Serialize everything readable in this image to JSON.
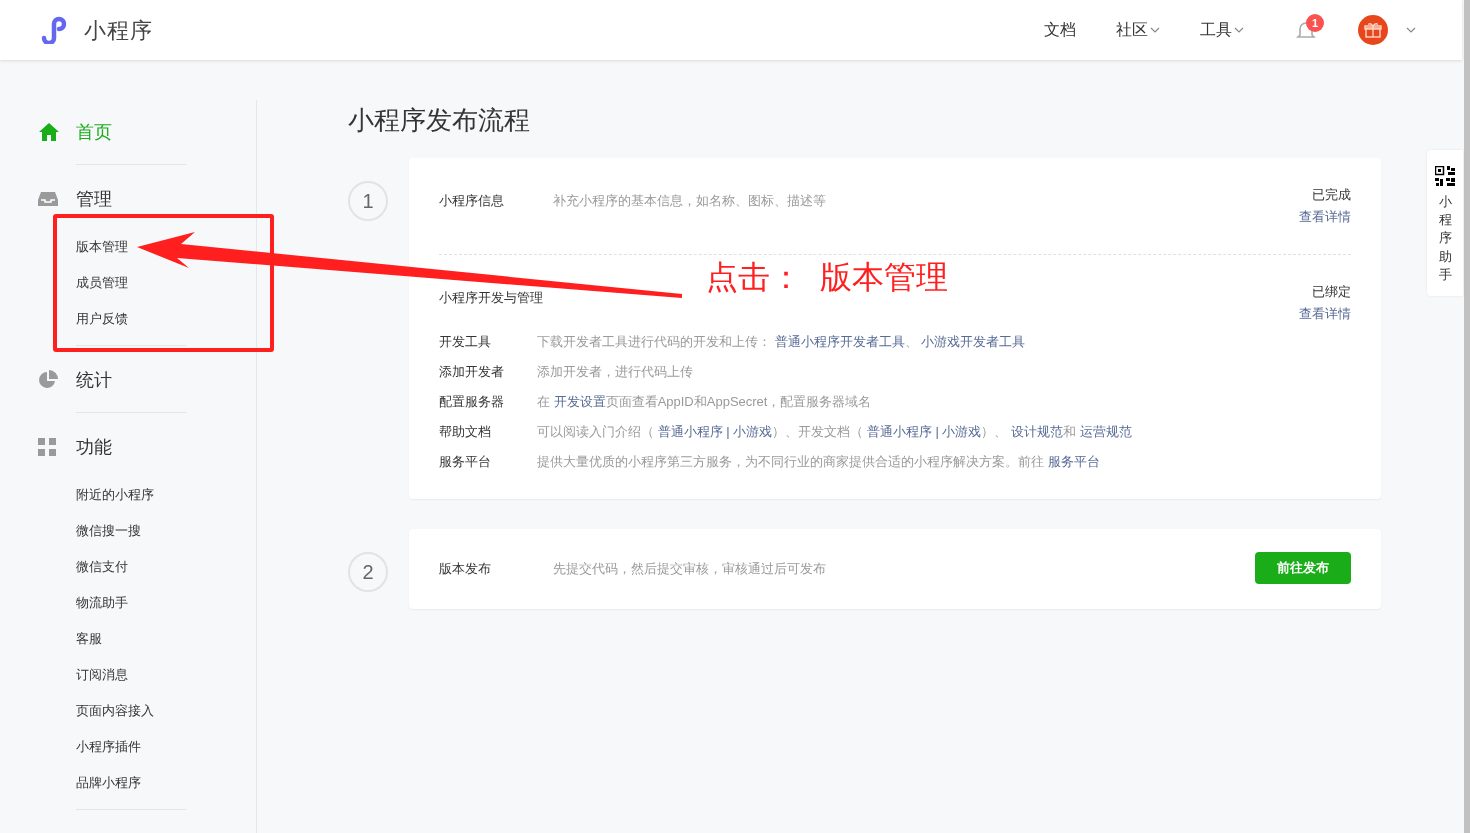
{
  "header": {
    "logo_text": "小程序",
    "nav": [
      {
        "label": "文档",
        "dropdown": false
      },
      {
        "label": "社区",
        "dropdown": true
      },
      {
        "label": "工具",
        "dropdown": true
      }
    ],
    "notification_count": "1"
  },
  "sidebar": {
    "groups": [
      {
        "label": "首页",
        "kind": "home",
        "selected": true
      },
      {
        "label": "管理",
        "kind": "manage",
        "selected": false,
        "items": [
          "版本管理",
          "成员管理",
          "用户反馈"
        ]
      },
      {
        "label": "统计",
        "kind": "stats",
        "selected": false
      },
      {
        "label": "功能",
        "kind": "features",
        "selected": false,
        "items": [
          "附近的小程序",
          "微信搜一搜",
          "微信支付",
          "物流助手",
          "客服",
          "订阅消息",
          "页面内容接入",
          "小程序插件",
          "品牌小程序"
        ]
      }
    ]
  },
  "page_title": "小程序发布流程",
  "steps": [
    {
      "number": "1",
      "sections": [
        {
          "title": "小程序信息",
          "description": "补充小程序的基本信息，如名称、图标、描述等",
          "status": "已完成",
          "link": "查看详情"
        },
        {
          "title": "小程序开发与管理",
          "status": "已绑定",
          "link": "查看详情",
          "rows": [
            {
              "label": "开发工具",
              "parts": [
                {
                  "kind": "text",
                  "text": "下载开发者工具进行代码的开发和上传： "
                },
                {
                  "kind": "link",
                  "text": "普通小程序开发者工具"
                },
                {
                  "kind": "text",
                  "text": "、 "
                },
                {
                  "kind": "link",
                  "text": "小游戏开发者工具"
                }
              ]
            },
            {
              "label": "添加开发者",
              "parts": [
                {
                  "kind": "text",
                  "text": "添加开发者，进行代码上传"
                }
              ]
            },
            {
              "label": "配置服务器",
              "parts": [
                {
                  "kind": "text",
                  "text": "在 "
                },
                {
                  "kind": "link",
                  "text": "开发设置"
                },
                {
                  "kind": "text",
                  "text": "页面查看AppID和AppSecret，配置服务器域名"
                }
              ]
            },
            {
              "label": "帮助文档",
              "parts": [
                {
                  "kind": "text",
                  "text": "可以阅读入门介绍（ "
                },
                {
                  "kind": "link",
                  "text": "普通小程序"
                },
                {
                  "kind": "sep",
                  "text": " | "
                },
                {
                  "kind": "link",
                  "text": "小游戏"
                },
                {
                  "kind": "text",
                  "text": "）、开发文档（ "
                },
                {
                  "kind": "link",
                  "text": "普通小程序"
                },
                {
                  "kind": "sep",
                  "text": " | "
                },
                {
                  "kind": "link",
                  "text": "小游戏"
                },
                {
                  "kind": "text",
                  "text": "）、 "
                },
                {
                  "kind": "link",
                  "text": "设计规范"
                },
                {
                  "kind": "text",
                  "text": "和 "
                },
                {
                  "kind": "link",
                  "text": "运营规范"
                }
              ]
            },
            {
              "label": "服务平台",
              "parts": [
                {
                  "kind": "text",
                  "text": "提供大量优质的小程序第三方服务，为不同行业的商家提供合适的小程序解决方案。前往 "
                },
                {
                  "kind": "link",
                  "text": "服务平台"
                }
              ]
            }
          ]
        }
      ]
    },
    {
      "number": "2",
      "sections": [
        {
          "title": "版本发布",
          "description": "先提交代码，然后提交审核，审核通过后可发布",
          "button": "前往发布"
        }
      ]
    }
  ],
  "helper": {
    "label": "小程序助手"
  },
  "annotation": {
    "text": "点击：  版本管理"
  }
}
